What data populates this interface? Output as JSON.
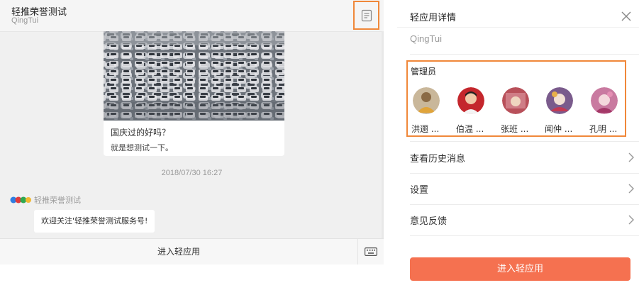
{
  "chat": {
    "title": "轻推荣誉测试",
    "subtitle": "QingTui",
    "card": {
      "title": "国庆过的好吗？",
      "description": "就是想测试一下。"
    },
    "timestamp": "2018/07/30 16:27",
    "sender": "轻推荣誉测试",
    "message": "欢迎关注'轻推荣誉测试服务号!",
    "footer_button": "进入轻应用"
  },
  "detail": {
    "title": "轻应用详情",
    "subtitle": "QingTui",
    "admins_label": "管理员",
    "admins": [
      {
        "name": "洪逦 ..."
      },
      {
        "name": "伯温 ..."
      },
      {
        "name": "张班 ..."
      },
      {
        "name": "闻仲 ..."
      },
      {
        "name": "孔明 ..."
      }
    ],
    "rows": [
      {
        "label": "查看历史消息"
      },
      {
        "label": "设置"
      },
      {
        "label": "意见反馈"
      }
    ],
    "enter_button": "进入轻应用"
  },
  "colors": {
    "highlight": "#f0883a",
    "primary_button": "#f57150"
  }
}
